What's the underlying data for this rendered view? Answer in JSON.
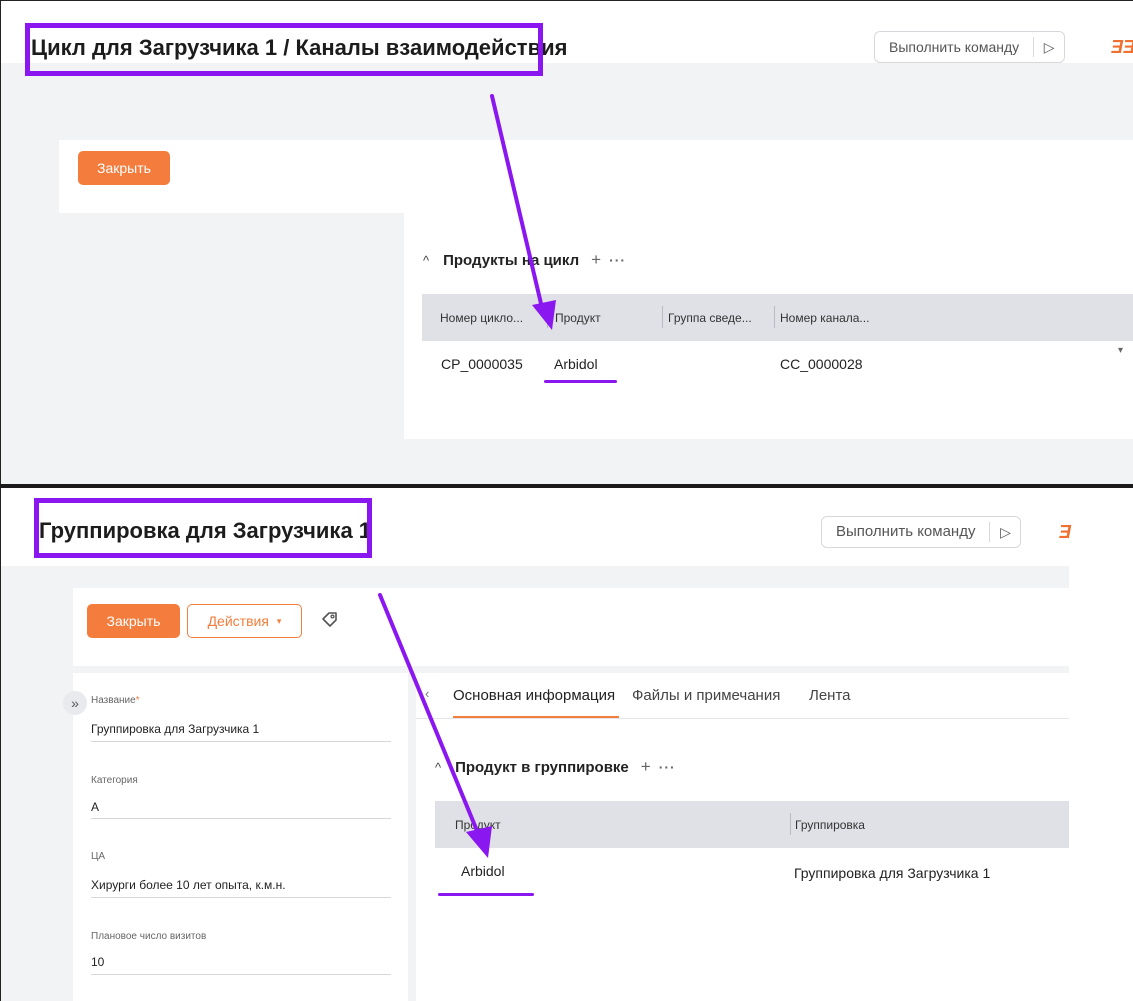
{
  "top": {
    "title": "Цикл для Загрузчика 1 / Каналы взаимодействия",
    "command_label": "Выполнить команду",
    "run_icon": "play-icon",
    "close_label": "Закрыть",
    "section_title": "Продукты на цикл",
    "columns": [
      "Номер цикло...",
      "Продукт",
      "Группа сведе...",
      "Номер канала..."
    ],
    "rows": [
      {
        "cycle_number": "CP_0000035",
        "product": "Arbidol",
        "group": "",
        "channel_number": "CC_0000028"
      }
    ]
  },
  "bottom": {
    "title": "Группировка для Загрузчика 1",
    "command_label": "Выполнить команду",
    "close_label": "Закрыть",
    "actions_label": "Действия",
    "fields": [
      {
        "label": "Название",
        "required": "*",
        "value": "Группировка для Загрузчика 1"
      },
      {
        "label": "Категория",
        "value": "А"
      },
      {
        "label": "ЦА",
        "value": "Хирурги более 10 лет опыта, к.м.н."
      },
      {
        "label": "Плановое число визитов",
        "value": "10"
      }
    ],
    "tabs": [
      "Основная информация",
      "Файлы и примечания",
      "Лента"
    ],
    "section_title": "Продукт в группировке",
    "columns": [
      "Продукт",
      "Группировка"
    ],
    "rows": [
      {
        "product": "Arbidol",
        "grouping": "Группировка для Загрузчика 1"
      }
    ]
  },
  "colors": {
    "accent": "#f47c3c",
    "annotation": "#8b17f0",
    "table_header": "#dfe1e6"
  }
}
